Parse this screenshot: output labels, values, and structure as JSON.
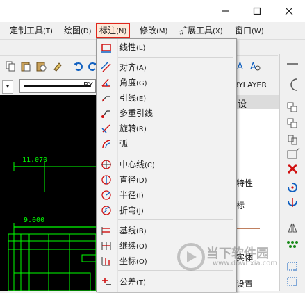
{
  "menubar": {
    "items": [
      {
        "label": "定制工具",
        "key": "(T)"
      },
      {
        "label": "绘图",
        "key": "(D)"
      },
      {
        "label": "标注",
        "key": "(N)"
      },
      {
        "label": "修改",
        "key": "(M)"
      },
      {
        "label": "扩展工具",
        "key": "(X)"
      },
      {
        "label": "窗口",
        "key": "(W)"
      }
    ]
  },
  "toolbar": {
    "linetype_value": "BY",
    "layer_value": "BYLAYER"
  },
  "canvas": {
    "dim1": "11.070",
    "dim2": "9.000"
  },
  "properties": {
    "header": "设",
    "label_props": "特性",
    "label_coords": "标",
    "label_entity": "实体",
    "label_settings": "设置"
  },
  "dropdown": {
    "items": [
      {
        "label": "线性",
        "key": "(L)",
        "icon": "linear-dim-icon"
      },
      {
        "label": "对齐",
        "key": "(A)",
        "icon": "aligned-dim-icon"
      },
      {
        "label": "角度",
        "key": "(G)",
        "icon": "angular-dim-icon"
      },
      {
        "label": "引线",
        "key": "(E)",
        "icon": "leader-icon"
      },
      {
        "label": "多重引线",
        "key": "",
        "icon": "multileader-icon"
      },
      {
        "label": "旋转",
        "key": "(R)",
        "icon": "rotated-dim-icon"
      },
      {
        "label": "弧",
        "key": "",
        "icon": "arc-length-icon"
      },
      {
        "label": "中心线",
        "key": "(C)",
        "icon": "centerline-icon"
      },
      {
        "label": "直径",
        "key": "(D)",
        "icon": "diameter-icon"
      },
      {
        "label": "半径",
        "key": "(I)",
        "icon": "radius-icon"
      },
      {
        "label": "折弯",
        "key": "(J)",
        "icon": "jogged-icon"
      },
      {
        "label": "基线",
        "key": "(B)",
        "icon": "baseline-icon"
      },
      {
        "label": "继续",
        "key": "(O)",
        "icon": "continue-icon"
      },
      {
        "label": "坐标",
        "key": "(O)",
        "icon": "ordinate-icon"
      },
      {
        "label": "公差",
        "key": "(T)",
        "icon": "tolerance-icon"
      }
    ]
  },
  "watermark": {
    "title": "当下软件园",
    "url": "www.downxia.com"
  },
  "colors": {
    "highlight_border": "#e0261b",
    "canvas_bg": "#000000",
    "cad_lines": "#00ff00",
    "icon_red": "#d01010",
    "icon_blue": "#1060c0"
  }
}
